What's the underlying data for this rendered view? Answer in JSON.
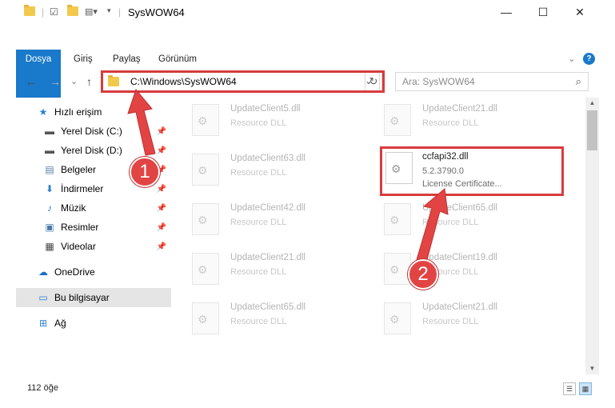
{
  "window": {
    "title": "SysWOW64",
    "controls": {
      "minimize": "—",
      "maximize": "☐",
      "close": "✕"
    }
  },
  "ribbon": {
    "tabs": [
      "Dosya",
      "Giriş",
      "Paylaş",
      "Görünüm"
    ],
    "expand_icon": "⌄",
    "help_icon": "?"
  },
  "navigation": {
    "back": "←",
    "forward": "→",
    "recent": "⌄",
    "up": "↑",
    "address": "C:\\Windows\\SysWOW64",
    "address_dropdown": "⌄",
    "refresh": "↻",
    "search_placeholder": "Ara: SysWOW64",
    "search_icon": "⌕"
  },
  "sidebar": {
    "items": [
      {
        "label": "Hızlı erişim",
        "icon": "star-icon",
        "glyph": "★",
        "pinned": false
      },
      {
        "label": "Yerel Disk (C:)",
        "icon": "drive-icon",
        "glyph": "▬",
        "pinned": true
      },
      {
        "label": "Yerel Disk (D:)",
        "icon": "drive-icon",
        "glyph": "▬",
        "pinned": true
      },
      {
        "label": "Belgeler",
        "icon": "documents-icon",
        "glyph": "▤",
        "pinned": true
      },
      {
        "label": "İndirmeler",
        "icon": "download-icon",
        "glyph": "⬇",
        "pinned": true
      },
      {
        "label": "Müzik",
        "icon": "music-icon",
        "glyph": "♪",
        "pinned": true
      },
      {
        "label": "Resimler",
        "icon": "pictures-icon",
        "glyph": "▣",
        "pinned": true
      },
      {
        "label": "Videolar",
        "icon": "video-icon",
        "glyph": "▦",
        "pinned": true
      },
      {
        "label": "OneDrive",
        "icon": "cloud-icon",
        "glyph": "☁",
        "pinned": false
      },
      {
        "label": "Bu bilgisayar",
        "icon": "computer-icon",
        "glyph": "▭",
        "pinned": false
      },
      {
        "label": "Ağ",
        "icon": "network-icon",
        "glyph": "⊞",
        "pinned": false
      }
    ],
    "pin_glyph": "📌"
  },
  "files": [
    {
      "name": "UpdateClient5.dll",
      "desc": "Resource DLL"
    },
    {
      "name": "UpdateClient21.dll",
      "desc": "Resource DLL"
    },
    {
      "name": "UpdateClient63.dll",
      "desc": "Resource DLL"
    },
    {
      "name": "ccfapi32.dll",
      "version": "5.2.3790.0",
      "desc": "License Certificate..."
    },
    {
      "name": "UpdateClient42.dll",
      "desc": "Resource DLL"
    },
    {
      "name": "UpdateClient65.dll",
      "desc": "Resource DLL"
    },
    {
      "name": "UpdateClient21.dll",
      "desc": "Resource DLL"
    },
    {
      "name": "UpdateClient19.dll",
      "desc": "Resource DLL"
    },
    {
      "name": "UpdateClient65.dll",
      "desc": "Resource DLL"
    },
    {
      "name": "UpdateClient21.dll",
      "desc": "Resource DLL"
    }
  ],
  "status": {
    "count": "112 öğe"
  },
  "annotations": {
    "step1": "1",
    "step2": "2",
    "color": "#d83c3c"
  }
}
